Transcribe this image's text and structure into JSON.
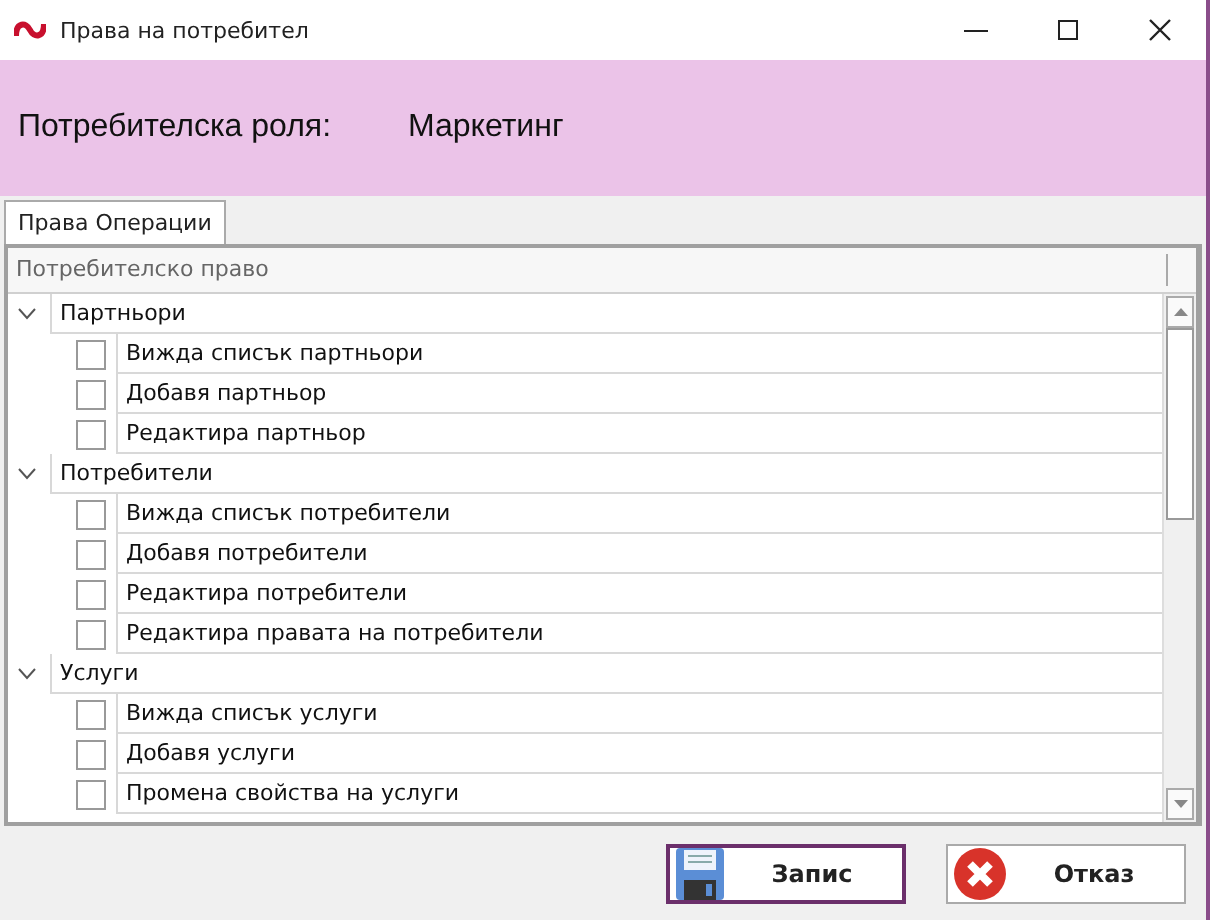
{
  "window": {
    "title": "Права на потребител"
  },
  "header": {
    "label": "Потребителска роля:",
    "value": "Маркетинг"
  },
  "tabs": [
    {
      "label": "Права Операции",
      "selected": true
    }
  ],
  "table": {
    "columns": [
      "Потребителско право"
    ],
    "groups": [
      {
        "label": "Партньори",
        "expanded": true,
        "children": [
          {
            "label": "Вижда списък партньори",
            "checked": false
          },
          {
            "label": "Добавя партньор",
            "checked": false
          },
          {
            "label": "Редактира партньор",
            "checked": false
          }
        ]
      },
      {
        "label": "Потребители",
        "expanded": true,
        "children": [
          {
            "label": "Вижда списък потребители",
            "checked": false
          },
          {
            "label": "Добавя потребители",
            "checked": false
          },
          {
            "label": "Редактира потребители",
            "checked": false
          },
          {
            "label": "Редактира правата на потребители",
            "checked": false
          }
        ]
      },
      {
        "label": "Услуги",
        "expanded": true,
        "children": [
          {
            "label": "Вижда списък услуги",
            "checked": false
          },
          {
            "label": "Добавя услуги",
            "checked": false
          },
          {
            "label": "Промена свойства на услуги",
            "checked": false
          }
        ]
      }
    ]
  },
  "buttons": [
    {
      "kind": "save",
      "label": "Запис",
      "selected": true
    },
    {
      "kind": "cancel",
      "label": "Отказ",
      "selected": false
    }
  ]
}
